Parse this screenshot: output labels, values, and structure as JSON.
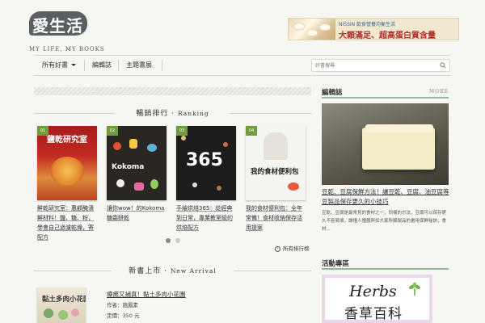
{
  "header": {
    "logo_text": "愛生活",
    "logo_subtitle": "MY LIFE, MY BOOKS",
    "banner_brand": "NISSIN  飲食營養均衡生活",
    "banner_text": "大顆滿足、超高蛋白質含量"
  },
  "nav": {
    "items": [
      "所有好書",
      "編輯誌",
      "主題書展"
    ],
    "search_placeholder": "好書搜尋"
  },
  "ranking": {
    "title_zh": "暢銷排行 ·",
    "title_en": "Ranking",
    "books": [
      {
        "rank": "01",
        "title": "鮮乾研究室：惠顧醃漬鮮材料！鹽、糖、粉，學會自己過濾乾燥，寄配方"
      },
      {
        "rank": "02",
        "title": "讓你wow！的Kokoma糖霜餅乾"
      },
      {
        "rank": "03",
        "title": "手繪烘焙365：從經典到日常，專業教室級的烘焙配方"
      },
      {
        "rank": "04",
        "title": "我的食材便利包：全年常備！食材收納保存活用提案"
      }
    ],
    "cover_texts": [
      "鹽乾研究室",
      "Kokoma",
      "365",
      "我的食材便利包"
    ],
    "all_link": "所有排行榜"
  },
  "new_arrival": {
    "title_zh": "新書上市 ·",
    "title_en": "New Arrival",
    "book_title": "療癒又捕真！黏土多肉小花園",
    "author_label": "作者：",
    "author": "施鳳素",
    "price_label": "定價：",
    "price": "350 元",
    "cover_text": "黏土多肉小花園"
  },
  "sidebar": {
    "editorial_title": "編輯誌",
    "more_label": "MORE",
    "article_title": "豆乾、豆腐保鮮方法！讓豆乾、豆腐、油豆腐等豆製品保存更久的小技巧",
    "article_desc": "豆乾、豆腐是最常見的食材之一，同樣的方法，豆腐可以保存更久不容易壞，讓懂人懂醬與如大家所解製品的書用保鮮秘訣，食材...",
    "activity_title": "活動專區",
    "herbs_en": "Herbs",
    "herbs_zh": "香草百科"
  },
  "colors": {
    "accent_green": "#8fb99a",
    "badge_green": "#6f9c3e",
    "background": "#f6f6f2"
  }
}
